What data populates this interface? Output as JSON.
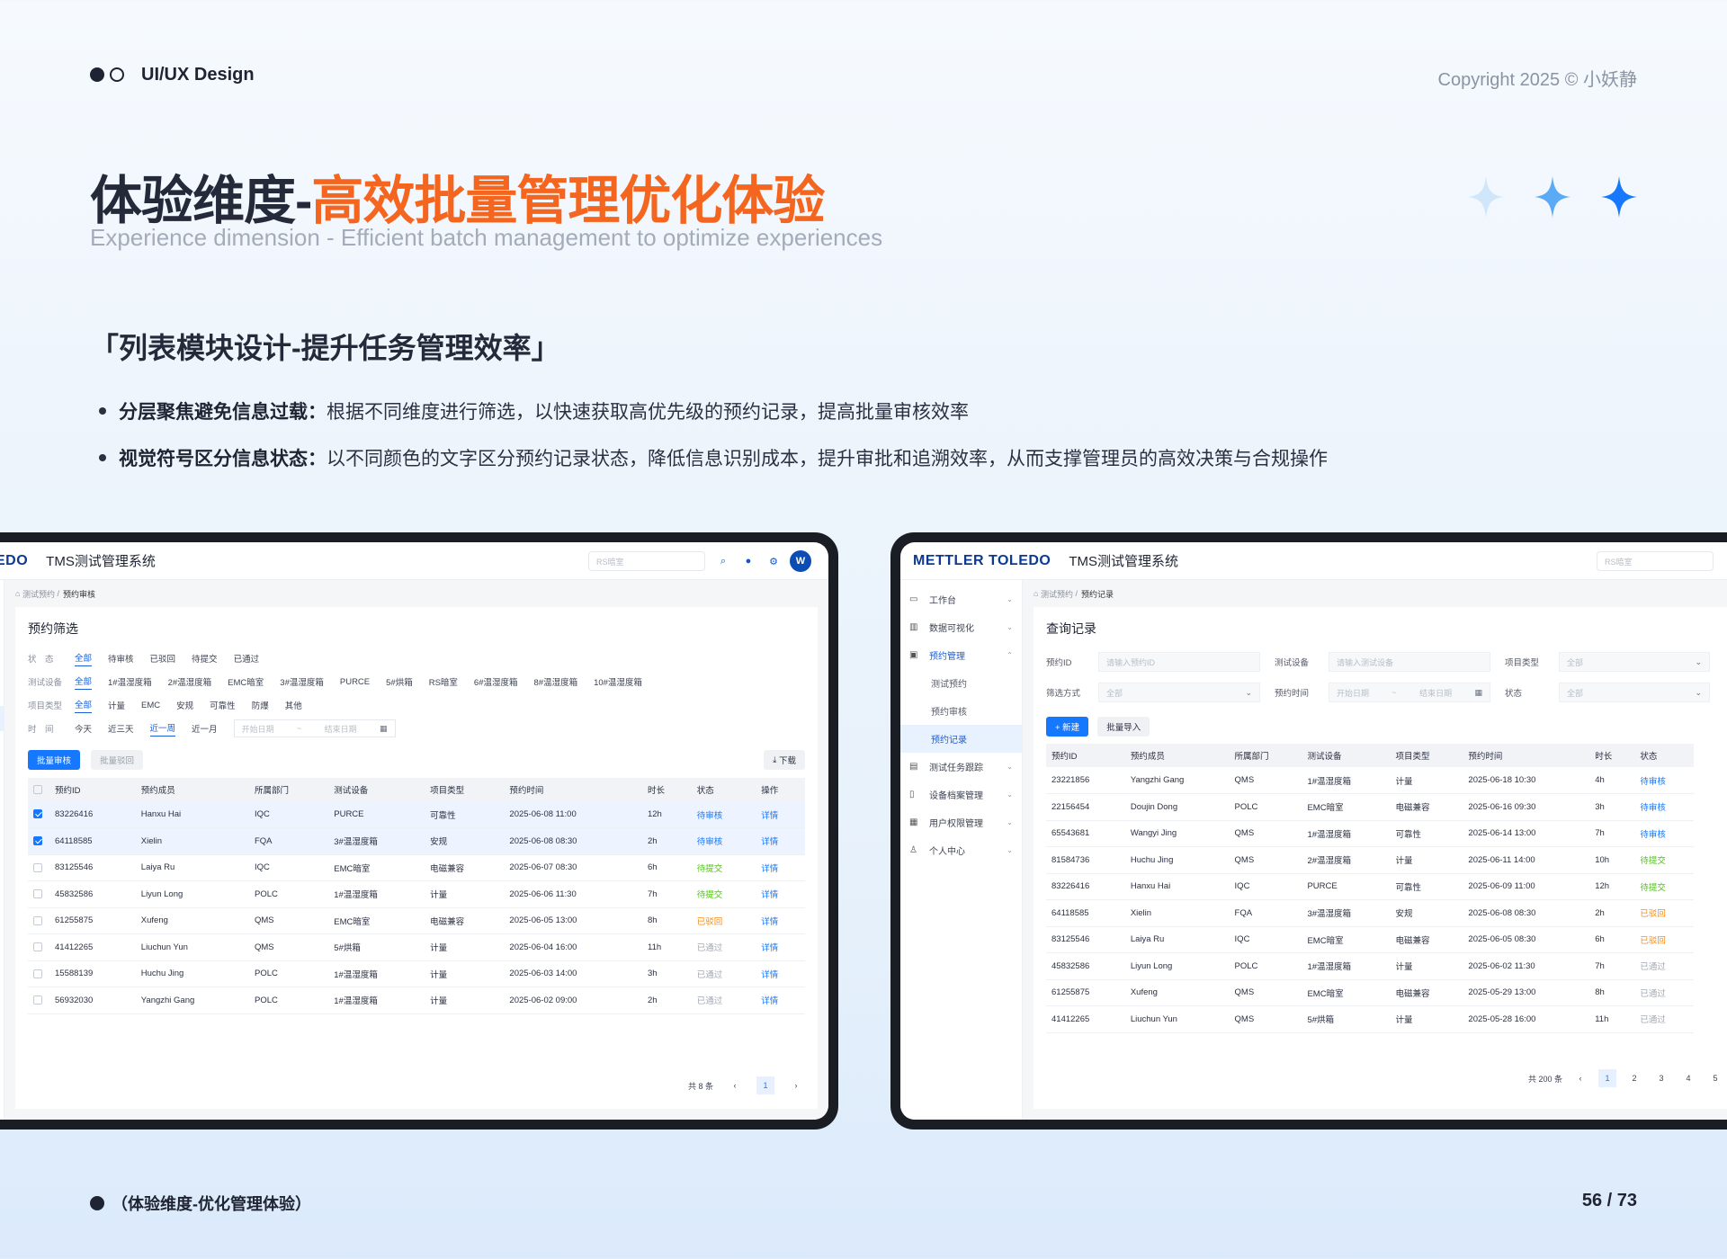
{
  "header": {
    "brand": "UI/UX Design",
    "copyright": "Copyright 2025  ©  小妖静"
  },
  "title": {
    "main": "体验维度-",
    "highlight": "高效批量管理优化体验",
    "subtitle": "Experience dimension - Efficient batch management to optimize experiences"
  },
  "section": {
    "heading": "「列表模块设计-提升任务管理效率」",
    "bullets": [
      {
        "bold": "分层聚焦避免信息过载：",
        "text": "根据不同维度进行筛选，以快速获取高优先级的预约记录，提高批量审核效率"
      },
      {
        "bold": "视觉符号区分信息状态：",
        "text": "以不同颜色的文字区分预约记录状态，降低信息识别成本，提升审批和追溯效率，从而支撑管理员的高效决策与合规操作"
      }
    ]
  },
  "colors": {
    "accent": "#f4661f",
    "primary": "#1677ff",
    "pending": "#1677ff",
    "submitted": "#52c41a",
    "rejected": "#fa8c16",
    "passed": "#a3a8b3"
  },
  "left_screen": {
    "logo_partial": "EDO",
    "system": "TMS测试管理系统",
    "search_placeholder": "RS暗室",
    "avatar": "W",
    "breadcrumb": {
      "home": "⌂",
      "l1": "测试预约",
      "sep": "/",
      "l2": "预约审核"
    },
    "panel_title": "预约筛选",
    "filters": [
      {
        "label": "状　态",
        "options": [
          "全部",
          "待审核",
          "已驳回",
          "待提交",
          "已通过"
        ],
        "active": 0
      },
      {
        "label": "测试设备",
        "options": [
          "全部",
          "1#温湿度箱",
          "2#温湿度箱",
          "EMC暗室",
          "3#温湿度箱",
          "PURCE",
          "5#烘箱",
          "RS暗室",
          "6#温湿度箱",
          "8#温湿度箱",
          "10#温湿度箱"
        ],
        "active": 0
      },
      {
        "label": "项目类型",
        "options": [
          "全部",
          "计量",
          "EMC",
          "安规",
          "可靠性",
          "防爆",
          "其他"
        ],
        "active": 0
      },
      {
        "label": "时　间",
        "options": [
          "今天",
          "近三天",
          "近一周",
          "近一月"
        ],
        "active": 2
      }
    ],
    "date_start": "开始日期",
    "date_sep": "~",
    "date_end": "结束日期",
    "batch_approve": "批量审核",
    "batch_reject": "批量驳回",
    "download": "下载",
    "columns": [
      "预约ID",
      "预约成员",
      "所属部门",
      "测试设备",
      "项目类型",
      "预约时间",
      "时长",
      "状态",
      "操作"
    ],
    "rows": [
      {
        "checked": true,
        "cells": [
          "83226416",
          "Hanxu Hai",
          "IQC",
          "PURCE",
          "可靠性",
          "2025-06-08 11:00",
          "12h"
        ],
        "status": "待审核",
        "s": "pend",
        "action": "详情"
      },
      {
        "checked": true,
        "cells": [
          "64118585",
          "Xielin",
          "FQA",
          "3#温湿度箱",
          "安规",
          "2025-06-08 08:30",
          "2h"
        ],
        "status": "待审核",
        "s": "pend",
        "action": "详情"
      },
      {
        "checked": false,
        "cells": [
          "83125546",
          "Laiya Ru",
          "IQC",
          "EMC暗室",
          "电磁兼容",
          "2025-06-07 08:30",
          "6h"
        ],
        "status": "待提交",
        "s": "sub",
        "action": "详情"
      },
      {
        "checked": false,
        "cells": [
          "45832586",
          "Liyun Long",
          "POLC",
          "1#温湿度箱",
          "计量",
          "2025-06-06 11:30",
          "7h"
        ],
        "status": "待提交",
        "s": "sub",
        "action": "详情"
      },
      {
        "checked": false,
        "cells": [
          "61255875",
          "Xufeng",
          "QMS",
          "EMC暗室",
          "电磁兼容",
          "2025-06-05 13:00",
          "8h"
        ],
        "status": "已驳回",
        "s": "rej",
        "action": "详情"
      },
      {
        "checked": false,
        "cells": [
          "41412265",
          "Liuchun Yun",
          "QMS",
          "5#烘箱",
          "计量",
          "2025-06-04 16:00",
          "11h"
        ],
        "status": "已通过",
        "s": "pass",
        "action": "详情"
      },
      {
        "checked": false,
        "cells": [
          "15588139",
          "Huchu Jing",
          "POLC",
          "1#温湿度箱",
          "计量",
          "2025-06-03 14:00",
          "3h"
        ],
        "status": "已通过",
        "s": "pass",
        "action": "详情"
      },
      {
        "checked": false,
        "cells": [
          "56932030",
          "Yangzhi Gang",
          "POLC",
          "1#温湿度箱",
          "计量",
          "2025-06-02 09:00",
          "2h"
        ],
        "status": "已通过",
        "s": "pass",
        "action": "详情"
      }
    ],
    "total": "共 8 条",
    "prev": "‹",
    "page": "1",
    "next": "›"
  },
  "right_screen": {
    "logo": "METTLER TOLEDO",
    "system": "TMS测试管理系统",
    "search_placeholder": "RS暗室",
    "sidebar": [
      {
        "label": "工作台",
        "icon": "monitor-icon",
        "glyph": "▭",
        "chev": "⌄",
        "type": "top"
      },
      {
        "label": "数据可视化",
        "icon": "chart-icon",
        "glyph": "▥",
        "chev": "⌄",
        "type": "top"
      },
      {
        "label": "预约管理",
        "icon": "calendar-icon",
        "glyph": "▣",
        "chev": "⌃",
        "type": "active"
      },
      {
        "label": "测试预约",
        "type": "sub"
      },
      {
        "label": "预约审核",
        "type": "sub"
      },
      {
        "label": "预约记录",
        "type": "sel"
      },
      {
        "label": "测试任务跟踪",
        "icon": "task-icon",
        "glyph": "▤",
        "chev": "⌄",
        "type": "top"
      },
      {
        "label": "设备档案管理",
        "icon": "file-icon",
        "glyph": "▯",
        "chev": "⌄",
        "type": "top"
      },
      {
        "label": "用户权限管理",
        "icon": "users-icon",
        "glyph": "▦",
        "chev": "⌄",
        "type": "top"
      },
      {
        "label": "个人中心",
        "icon": "user-icon",
        "glyph": "♙",
        "chev": "⌄",
        "type": "top"
      }
    ],
    "breadcrumb": {
      "home": "⌂",
      "l1": "测试预约",
      "sep": "/",
      "l2": "预约记录"
    },
    "panel_title": "查询记录",
    "query": {
      "id_label": "预约ID",
      "id_ph": "请输入预约ID",
      "dev_label": "测试设备",
      "dev_ph": "请输入测试设备",
      "type_label": "项目类型",
      "type_val": "全部",
      "mode_label": "筛选方式",
      "mode_val": "全部",
      "time_label": "预约时间",
      "start": "开始日期",
      "sep": "~",
      "end": "结束日期",
      "status_label": "状态",
      "status_val": "全部"
    },
    "new_btn": "+ 新建",
    "import_btn": "批量导入",
    "columns": [
      "预约ID",
      "预约成员",
      "所属部门",
      "测试设备",
      "项目类型",
      "预约时间",
      "时长",
      "状态"
    ],
    "rows": [
      {
        "cells": [
          "23221856",
          "Yangzhi Gang",
          "QMS",
          "1#温湿度箱",
          "计量",
          "2025-06-18 10:30",
          "4h"
        ],
        "status": "待审核",
        "s": "pend"
      },
      {
        "cells": [
          "22156454",
          "Doujin Dong",
          "POLC",
          "EMC暗室",
          "电磁兼容",
          "2025-06-16 09:30",
          "3h"
        ],
        "status": "待审核",
        "s": "pend"
      },
      {
        "cells": [
          "65543681",
          "Wangyi Jing",
          "QMS",
          "1#温湿度箱",
          "可靠性",
          "2025-06-14 13:00",
          "7h"
        ],
        "status": "待审核",
        "s": "pend"
      },
      {
        "cells": [
          "81584736",
          "Huchu Jing",
          "QMS",
          "2#温湿度箱",
          "计量",
          "2025-06-11 14:00",
          "10h"
        ],
        "status": "待提交",
        "s": "sub"
      },
      {
        "cells": [
          "83226416",
          "Hanxu Hai",
          "IQC",
          "PURCE",
          "可靠性",
          "2025-06-09 11:00",
          "12h"
        ],
        "status": "待提交",
        "s": "sub"
      },
      {
        "cells": [
          "64118585",
          "Xielin",
          "FQA",
          "3#温湿度箱",
          "安规",
          "2025-06-08 08:30",
          "2h"
        ],
        "status": "已驳回",
        "s": "rej"
      },
      {
        "cells": [
          "83125546",
          "Laiya Ru",
          "IQC",
          "EMC暗室",
          "电磁兼容",
          "2025-06-05 08:30",
          "6h"
        ],
        "status": "已驳回",
        "s": "rej"
      },
      {
        "cells": [
          "45832586",
          "Liyun Long",
          "POLC",
          "1#温湿度箱",
          "计量",
          "2025-06-02 11:30",
          "7h"
        ],
        "status": "已通过",
        "s": "pass"
      },
      {
        "cells": [
          "61255875",
          "Xufeng",
          "QMS",
          "EMC暗室",
          "电磁兼容",
          "2025-05-29 13:00",
          "8h"
        ],
        "status": "已通过",
        "s": "pass"
      },
      {
        "cells": [
          "41412265",
          "Liuchun Yun",
          "QMS",
          "5#烘箱",
          "计量",
          "2025-05-28 16:00",
          "11h"
        ],
        "status": "已通过",
        "s": "pass"
      }
    ],
    "total": "共 200 条",
    "prev": "‹",
    "pages": [
      "1",
      "2",
      "3",
      "4",
      "5"
    ]
  },
  "footer": {
    "label": "（体验维度-优化管理体验）",
    "page": "56 / 73"
  }
}
